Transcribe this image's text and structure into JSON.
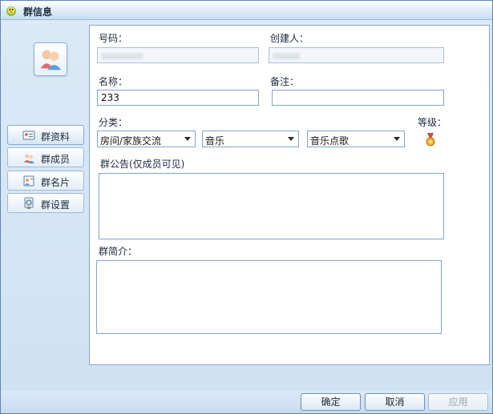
{
  "window": {
    "title": "群信息",
    "title_icon": "qq-penguin-icon"
  },
  "sidebar": {
    "avatar_icon": "group-users-icon",
    "items": [
      {
        "label": "群资料",
        "icon": "id-card-icon",
        "active": true
      },
      {
        "label": "群成员",
        "icon": "members-icon",
        "active": false
      },
      {
        "label": "群名片",
        "icon": "name-card-icon",
        "active": false
      },
      {
        "label": "群设置",
        "icon": "settings-icon",
        "active": false
      }
    ]
  },
  "form": {
    "number_label": "号码：",
    "creator_label": "创建人：",
    "name_label": "名称：",
    "name_value": "233",
    "remark_label": "备注：",
    "remark_value": "",
    "category_label": "分类：",
    "category1": "房间/家族交流",
    "category2": "音乐",
    "category3": "音乐点歌",
    "level_label": "等级：",
    "level_icon": "medal-icon",
    "notice_label": "群公告(仅成员可见)",
    "notice_value": "",
    "intro_label": "群简介：",
    "intro_value": ""
  },
  "buttons": {
    "ok": "确定",
    "cancel": "取消",
    "apply": "应用"
  }
}
